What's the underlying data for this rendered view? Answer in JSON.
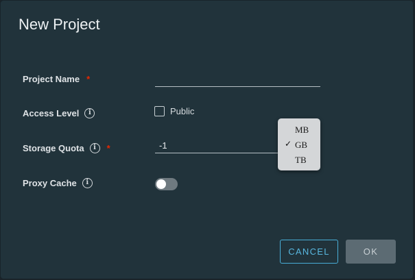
{
  "dialog": {
    "title": "New Project"
  },
  "fields": {
    "project_name": {
      "label": "Project Name",
      "required_mark": "*",
      "value": ""
    },
    "access_level": {
      "label": "Access Level",
      "info_icon": "i",
      "checkbox_label": "Public",
      "checked": false
    },
    "storage_quota": {
      "label": "Storage Quota",
      "info_icon": "i",
      "required_mark": "*",
      "value": "-1",
      "unit_options": [
        "MB",
        "GB",
        "TB"
      ],
      "selected_unit": "GB",
      "check_mark": "✓"
    },
    "proxy_cache": {
      "label": "Proxy Cache",
      "info_icon": "i",
      "enabled": false
    }
  },
  "buttons": {
    "cancel_label": "CANCEL",
    "ok_label": "OK"
  },
  "colors": {
    "dialog_background": "#21333b",
    "required": "#e62700",
    "accent": "#49afd9",
    "ok_button_background": "#5c6b73"
  },
  "icons": {
    "info": "info-icon",
    "check": "check-icon"
  }
}
